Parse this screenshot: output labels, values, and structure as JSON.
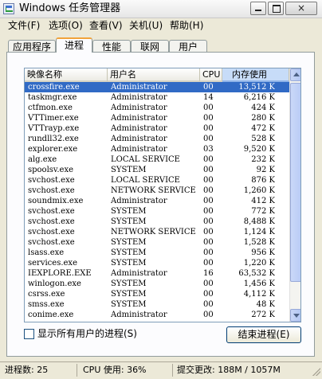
{
  "window": {
    "title": "Windows 任务管理器",
    "close_glyph": "×"
  },
  "menu": [
    "文件(F)",
    "选项(O)",
    "查看(V)",
    "关机(U)",
    "帮助(H)"
  ],
  "tabs": [
    "应用程序",
    "进程",
    "性能",
    "联网",
    "用户"
  ],
  "active_tab": 1,
  "columns": {
    "name": "映像名称",
    "user": "用户名",
    "cpu": "CPU",
    "mem": "内存使用"
  },
  "sorted_column": "mem",
  "selected_row": 0,
  "processes": [
    {
      "name": "crossfire.exe",
      "user": "Administrator",
      "cpu": "00",
      "mem": "13,512 K"
    },
    {
      "name": "taskmgr.exe",
      "user": "Administrator",
      "cpu": "14",
      "mem": "6,216 K"
    },
    {
      "name": "ctfmon.exe",
      "user": "Administrator",
      "cpu": "00",
      "mem": "424 K"
    },
    {
      "name": "VTTimer.exe",
      "user": "Administrator",
      "cpu": "00",
      "mem": "280 K"
    },
    {
      "name": "VTTrayp.exe",
      "user": "Administrator",
      "cpu": "00",
      "mem": "472 K"
    },
    {
      "name": "rundll32.exe",
      "user": "Administrator",
      "cpu": "00",
      "mem": "528 K"
    },
    {
      "name": "explorer.exe",
      "user": "Administrator",
      "cpu": "03",
      "mem": "9,520 K"
    },
    {
      "name": "alg.exe",
      "user": "LOCAL SERVICE",
      "cpu": "00",
      "mem": "232 K"
    },
    {
      "name": "spoolsv.exe",
      "user": "SYSTEM",
      "cpu": "00",
      "mem": "92 K"
    },
    {
      "name": "svchost.exe",
      "user": "LOCAL SERVICE",
      "cpu": "00",
      "mem": "876 K"
    },
    {
      "name": "svchost.exe",
      "user": "NETWORK SERVICE",
      "cpu": "00",
      "mem": "1,260 K"
    },
    {
      "name": "soundmix.exe",
      "user": "Administrator",
      "cpu": "00",
      "mem": "412 K"
    },
    {
      "name": "svchost.exe",
      "user": "SYSTEM",
      "cpu": "00",
      "mem": "772 K"
    },
    {
      "name": "svchost.exe",
      "user": "SYSTEM",
      "cpu": "00",
      "mem": "8,488 K"
    },
    {
      "name": "svchost.exe",
      "user": "NETWORK SERVICE",
      "cpu": "00",
      "mem": "1,124 K"
    },
    {
      "name": "svchost.exe",
      "user": "SYSTEM",
      "cpu": "00",
      "mem": "1,528 K"
    },
    {
      "name": "lsass.exe",
      "user": "SYSTEM",
      "cpu": "00",
      "mem": "956 K"
    },
    {
      "name": "services.exe",
      "user": "SYSTEM",
      "cpu": "00",
      "mem": "1,220 K"
    },
    {
      "name": "IEXPLORE.EXE",
      "user": "Administrator",
      "cpu": "16",
      "mem": "63,532 K"
    },
    {
      "name": "winlogon.exe",
      "user": "SYSTEM",
      "cpu": "00",
      "mem": "1,456 K"
    },
    {
      "name": "csrss.exe",
      "user": "SYSTEM",
      "cpu": "00",
      "mem": "4,112 K"
    },
    {
      "name": "smss.exe",
      "user": "SYSTEM",
      "cpu": "00",
      "mem": "48 K"
    },
    {
      "name": "conime.exe",
      "user": "Administrator",
      "cpu": "00",
      "mem": "272 K"
    }
  ],
  "show_all_users_label": "显示所有用户的进程(S)",
  "end_process_label": "结束进程(E)",
  "status": {
    "processes": "进程数: 25",
    "cpu": "CPU 使用: 36%",
    "commit": "提交更改: 188M / 1057M"
  },
  "colors": {
    "selection": "#316ac5",
    "tab_highlight": "#f1a33a"
  }
}
